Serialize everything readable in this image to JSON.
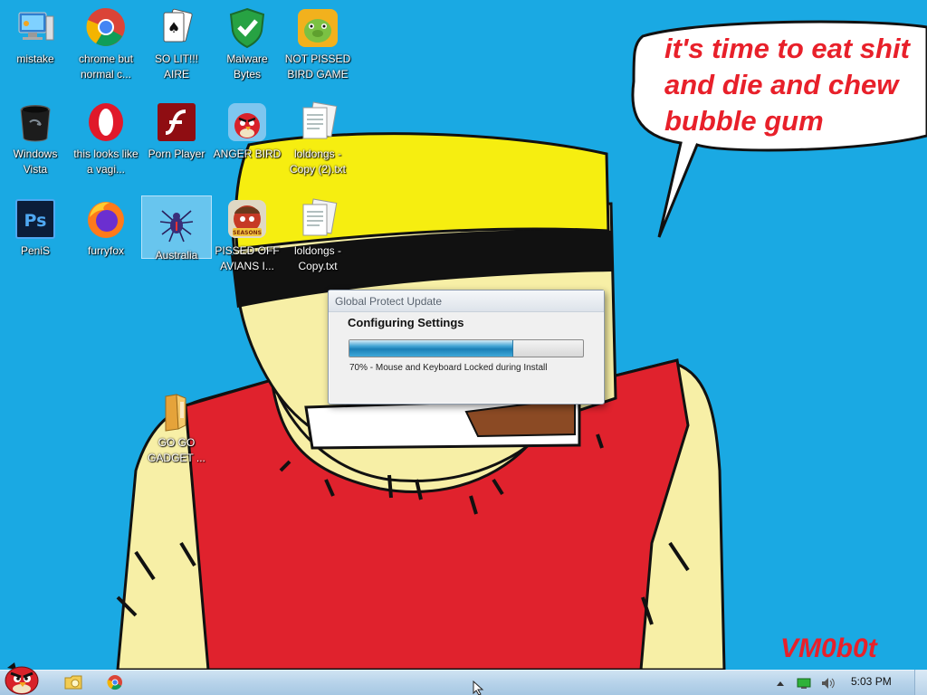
{
  "desktop": {
    "icons": [
      {
        "label": "mistake",
        "icon": "computer-icon"
      },
      {
        "label": "chrome but normal c...",
        "icon": "chrome-icon"
      },
      {
        "label": "SO LIT!!! AIRE",
        "icon": "solitaire-icon"
      },
      {
        "label": "Malware Bytes",
        "icon": "shield-icon"
      },
      {
        "label": "NOT PISSED BIRD GAME",
        "icon": "bad-piggies-icon"
      },
      {
        "label": "Windows Vista",
        "icon": "trash-icon"
      },
      {
        "label": "this looks like a vagi...",
        "icon": "opera-icon"
      },
      {
        "label": "Porn Player",
        "icon": "flash-icon"
      },
      {
        "label": "ANGER BIRD",
        "icon": "angry-bird-icon"
      },
      {
        "label": "loldongs - Copy (2).txt",
        "icon": "text-file-icon"
      },
      {
        "label": "PeniS",
        "icon": "photoshop-icon"
      },
      {
        "label": "furryfox",
        "icon": "firefox-icon"
      },
      {
        "label": "Australia",
        "icon": "spider-solitaire-icon"
      },
      {
        "label": "PISSED OFF AVIANS I...",
        "icon": "angry-birds-seasons-icon"
      },
      {
        "label": "loldongs - Copy.txt",
        "icon": "text-file-icon"
      },
      {
        "label": "GO GO GADGET ...",
        "icon": "folder-icon"
      }
    ],
    "bubble_text": [
      "it's time to eat shit",
      "and die and chew",
      "bubble gum"
    ],
    "signature": "VM0b0t"
  },
  "dialog": {
    "title": "Global Protect Update",
    "heading": "Configuring Settings",
    "progress_percent": 70,
    "status": "70% - Mouse and Keyboard Locked during Install"
  },
  "taskbar": {
    "start_icon": "angry-bird-start-icon",
    "pinned": [
      "explorer-icon",
      "chrome-icon"
    ],
    "tray_icons": [
      "show-hidden-icon",
      "network-icon",
      "volume-icon"
    ],
    "clock": "5:03 PM"
  },
  "colors": {
    "desktop": "#1aa9e3",
    "bubble_text": "#e8202a",
    "progress": "#1a7fb7"
  }
}
